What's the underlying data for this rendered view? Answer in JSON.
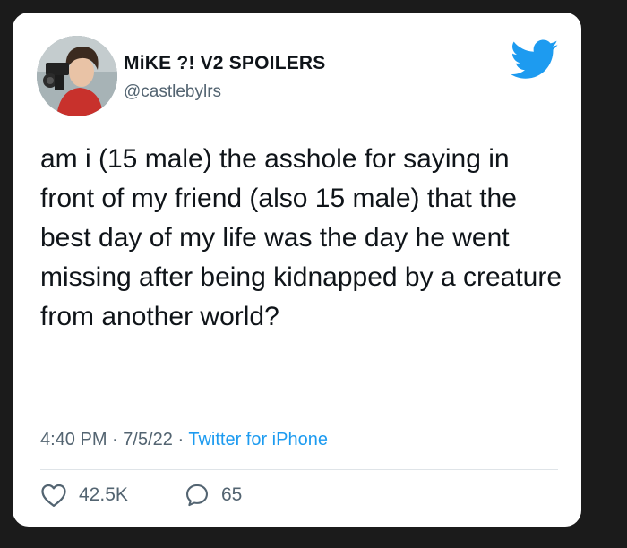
{
  "tweet": {
    "display_name": "MiKE ?! V2 SPOILERS",
    "handle": "@castlebylrs",
    "text": "am i (15 male) the asshole for saying in front of my friend (also 15 male) that the best day of my life was the day he went missing after being kidnapped by a creature from another world?",
    "time": "4:40 PM",
    "separator": "·",
    "date": "7/5/22",
    "source": "Twitter for iPhone",
    "likes": "42.5K",
    "replies": "65"
  },
  "icons": {
    "brand": "twitter-bird-icon",
    "like": "heart-icon",
    "reply": "reply-bubble-icon"
  },
  "colors": {
    "brand": "#1d9bf0",
    "text": "#0f1419",
    "secondary": "#536471",
    "background": "#1b1b1b"
  }
}
